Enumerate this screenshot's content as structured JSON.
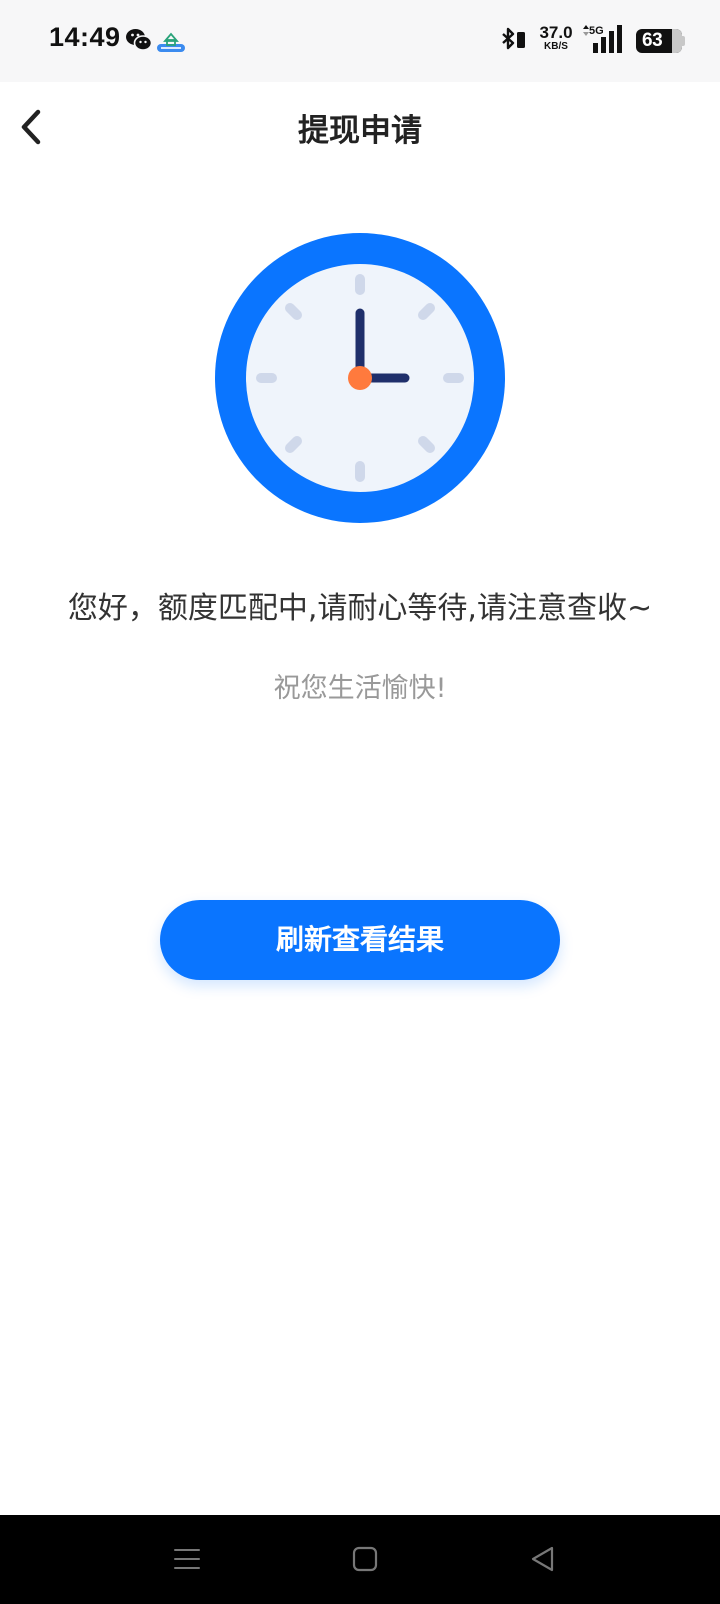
{
  "status_bar": {
    "time": "14:49",
    "net_speed_value": "37.0",
    "net_speed_unit": "KB/S",
    "network_type": "5G",
    "battery_level": "63",
    "icons": [
      "wechat-icon",
      "app-notification-icon",
      "bluetooth-icon",
      "signal-icon",
      "battery-icon"
    ]
  },
  "header": {
    "title": "提现申请",
    "back_icon": "chevron-left-icon"
  },
  "main": {
    "illustration_icon": "clock-icon",
    "message": "您好，额度匹配中,请耐心等待,请注意查收~",
    "wish": "祝您生活愉快!",
    "refresh_button_label": "刷新查看结果"
  },
  "colors": {
    "accent": "#0a75ff",
    "clock_face": "#eff4fb",
    "clock_hands": "#1f2f6b",
    "clock_center": "#ff7a3d",
    "tick_marks": "#cfd8ea",
    "message_text": "#333333",
    "wish_text": "#999999"
  },
  "system_nav": {
    "icons": [
      "menu-icon",
      "home-icon",
      "back-triangle-icon"
    ]
  }
}
